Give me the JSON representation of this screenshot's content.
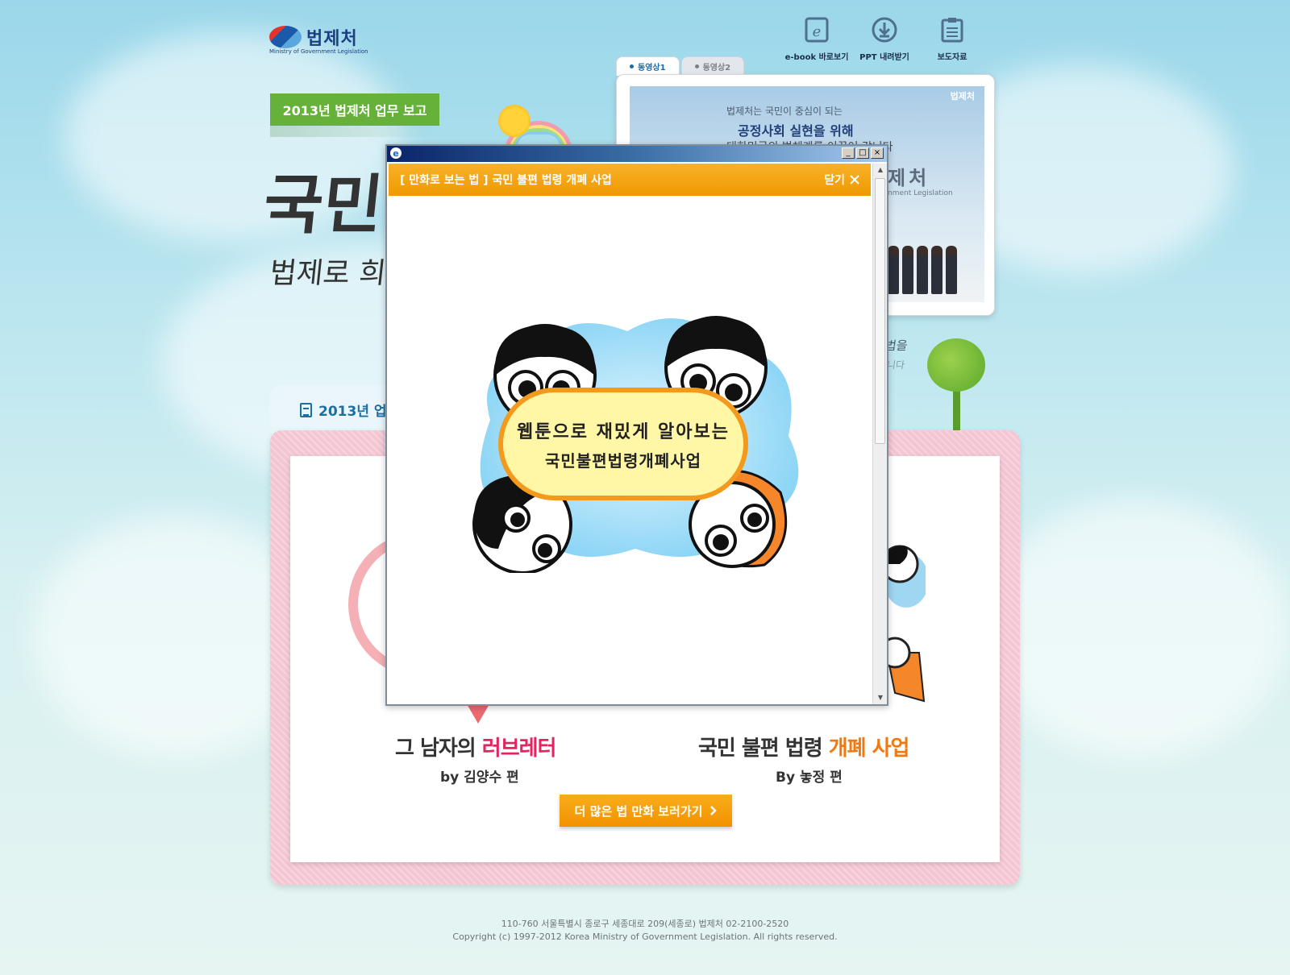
{
  "header": {
    "logo_ko": "법제처",
    "logo_en": "Ministry of Government Legislation",
    "links": [
      {
        "label": "e-book 바로보기",
        "icon": "ebook-icon"
      },
      {
        "label": "PPT 내려받기",
        "icon": "download-icon"
      },
      {
        "label": "보도자료",
        "icon": "clipboard-icon"
      }
    ]
  },
  "hero": {
    "tag": "2013년 법제처 업무 보고",
    "headline": "국민",
    "subheadline": "법제로 희",
    "tree_text": "법을",
    "tree_text2": "니다"
  },
  "video": {
    "tabs": [
      {
        "label": "동영상1",
        "active": true
      },
      {
        "label": "동영상2",
        "active": false
      }
    ],
    "brand": "법제처",
    "line1": "법제처는 국민이 중심이 되는",
    "line2": "공정사회 실현을 위해",
    "line3": "대한민국의 법체계를 이끌어 갑니다",
    "big": "제처",
    "small": "nment Legislation"
  },
  "board": {
    "tab_label": "2013년 업",
    "left_title_prefix": "그 남자의 ",
    "left_title_highlight": "러브레터",
    "left_by": "by 김양수 편",
    "right_title_prefix": "국민 불편 법령 ",
    "right_title_highlight": "개폐 사업",
    "right_by": "By 놓정 편",
    "more_button": "더 많은 법 만화 보러가기"
  },
  "footer": {
    "address": "110-760 서울특별시 종로구 세종대로 209(세종로) 법제처 02-2100-2520",
    "copyright": "Copyright (c) 1997-2012 Korea Ministry of Government Legislation. All rights reserved."
  },
  "popup": {
    "title": "[ 만화로 보는 법 ] 국민 불편 법령 개폐 사업",
    "close_label": "닫기",
    "window_buttons": [
      "_",
      "□",
      "×"
    ],
    "comic_line1": "웹툰으로 재밌게 알아보는",
    "comic_line2": "국민불편법령개폐사업"
  },
  "colors": {
    "accent_orange": "#f29100",
    "accent_green": "#66b13a",
    "highlight_pink": "#e4245e",
    "highlight_orange": "#f07a10",
    "board_pink": "#f4c6d3"
  }
}
